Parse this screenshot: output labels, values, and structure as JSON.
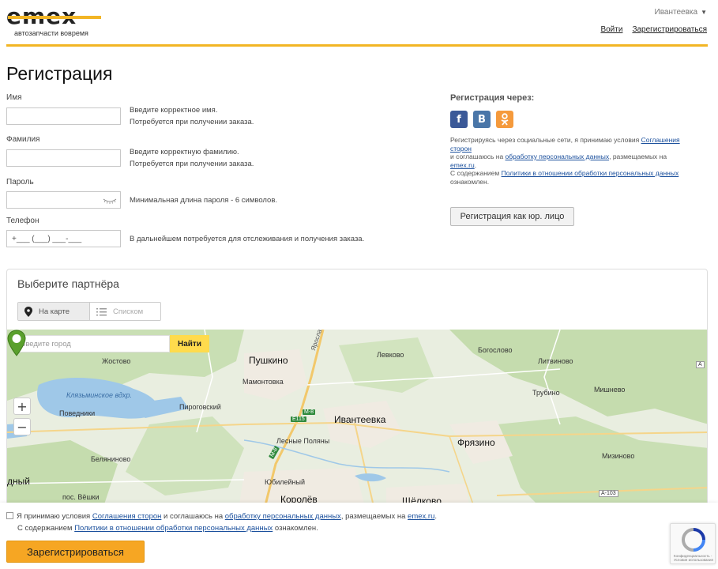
{
  "header": {
    "logo_text": "emex",
    "logo_tagline": "автозапчасти вовремя",
    "city": "Ивантеевка",
    "login": "Войти",
    "register": "Зарегистрироваться"
  },
  "page_title": "Регистрация",
  "form": {
    "first_name": {
      "label": "Имя",
      "value": "",
      "hint1": "Введите корректное имя.",
      "hint2": "Потребуется при получении заказа."
    },
    "last_name": {
      "label": "Фамилия",
      "value": "",
      "hint1": "Введите корректную фамилию.",
      "hint2": "Потребуется при получении заказа."
    },
    "password": {
      "label": "Пароль",
      "value": "",
      "hint1": "Минимальная длина пароля - 6 символов."
    },
    "phone": {
      "label": "Телефон",
      "value": "+___ (___) ___-___",
      "hint1": "В дальнейшем потребуется для отслеживания и получения заказа."
    }
  },
  "social": {
    "title": "Регистрация через:",
    "buttons": [
      "f",
      "В",
      "ok-icon"
    ],
    "text_1": "Регистрируясь через социальные сети, я принимаю условия ",
    "link_agreement": "Соглашения сторон",
    "text_2": " и соглашаюсь на ",
    "link_personal": "обработку персональных данных",
    "text_3": ", размещаемых на ",
    "link_site": "emex.ru",
    "text_4": ".",
    "text_5": "С содержанием ",
    "link_policy": "Политики в отношении обработки персональных данных",
    "text_6": " ознакомлен."
  },
  "legal_entity_button": "Регистрация как юр. лицо",
  "partner": {
    "title": "Выберите партнёра",
    "tab_map": "На карте",
    "tab_list": "Списком",
    "search_placeholder": "Введите город",
    "search_button": "Найти",
    "zoom_in": "+",
    "zoom_out": "−",
    "places": {
      "pushkino": "Пушкино",
      "ivanteevka": "Ивантеевка",
      "fryazino": "Фрязино",
      "korolev": "Королёв",
      "shchelkovo": "Щёлково",
      "zhostovo": "Жостово",
      "mamontovka": "Мамонтовка",
      "levkovo": "Левково",
      "bogoslovo": "Богослово",
      "litvinovo": "Литвиново",
      "klyazma": "Клязьминское вдхр.",
      "pirogovsky": "Пироговский",
      "povedniki": "Поведники",
      "trubino": "Трубино",
      "mishnevo": "Мишнево",
      "lesnye_polyany": "Лесные Поляны",
      "belyaninovo": "Беляниново",
      "mizinovo": "Мизиново",
      "yubileyny": "Юбилейный",
      "mytishchi_part": "дный",
      "poselok_vyoshki": "пос. Вёшки",
      "yaroslavskoe": "Ярославское ш.",
      "road_m8": "M-8",
      "road_e115": "E115",
      "road_a103": "A-103",
      "road_m8b": "M-8",
      "road_a": "А"
    }
  },
  "agreement": {
    "text_1": "Я принимаю условия ",
    "link_agreement": "Соглашения сторон",
    "text_2": " и соглашаюсь на ",
    "link_personal": "обработку персональных данных",
    "text_3": ", размещаемых на ",
    "link_site": "emex.ru",
    "text_4": ".",
    "text_5": "С содержанием ",
    "link_policy": "Политики в отношении обработки персональных данных",
    "text_6": " ознакомлен."
  },
  "submit_button": "Зарегистрироваться",
  "recaptcha": {
    "line1": "Конфиденциальность -",
    "line2": "Условия использования"
  },
  "colors": {
    "accent": "#f2b525",
    "button": "#f6a623",
    "link": "#1a4f9c"
  }
}
